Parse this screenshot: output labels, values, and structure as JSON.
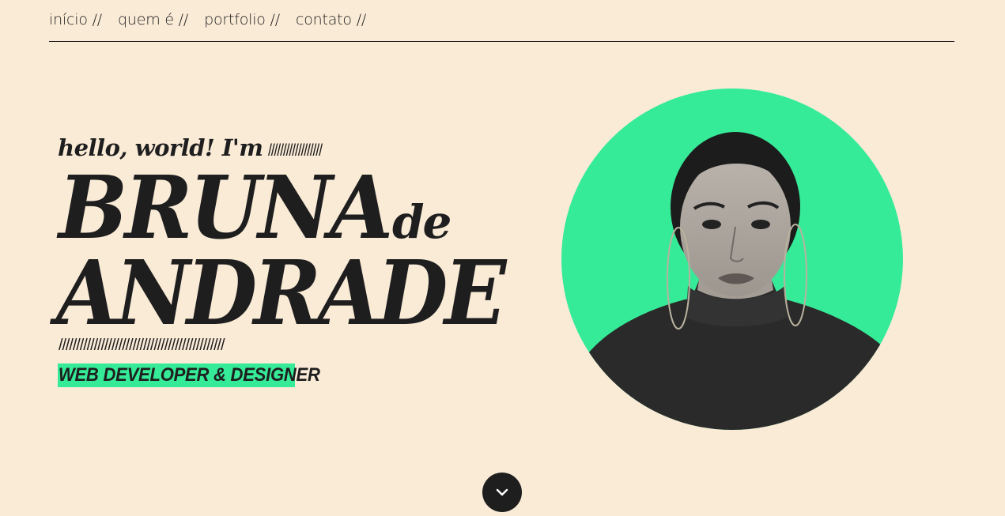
{
  "nav": {
    "items": [
      {
        "label": "início //"
      },
      {
        "label": "quem é //"
      },
      {
        "label": "portfolio //"
      },
      {
        "label": "contato //"
      }
    ]
  },
  "hero": {
    "greeting": "hello, world! I'm",
    "greeting_slashes": "//////////////////",
    "first_name": "BRUNA",
    "name_particle": "de",
    "last_name": "ANDRADE",
    "divider_slashes": "///////////////////////////////////////////////",
    "role": "WEB DEVELOPER & DESIGNER"
  },
  "colors": {
    "background": "#faebd7",
    "accent": "#36eb98",
    "ink": "#1e1e1e"
  },
  "icons": {
    "scroll": "chevron-down-icon"
  }
}
